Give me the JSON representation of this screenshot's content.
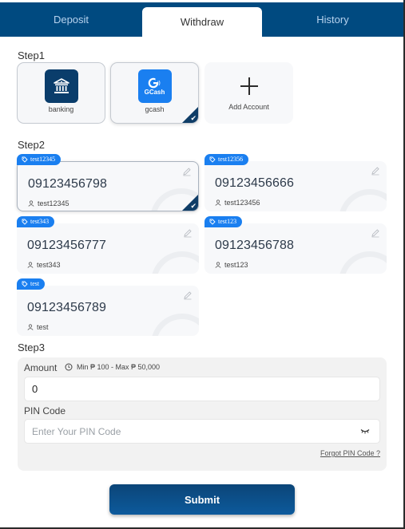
{
  "tabs": [
    {
      "label": "Deposit",
      "active": false
    },
    {
      "label": "Withdraw",
      "active": true
    },
    {
      "label": "History",
      "active": false
    }
  ],
  "step1": {
    "label": "Step1",
    "methods": [
      {
        "label": "banking",
        "icon": "bank-icon",
        "selected": false
      },
      {
        "label": "gcash",
        "icon": "gcash-logo",
        "logo_text": "GCash",
        "selected": true
      },
      {
        "label": "Add Account",
        "icon": "plus-icon"
      }
    ]
  },
  "step2": {
    "label": "Step2",
    "accounts": [
      {
        "tag": "test12345",
        "number": "09123456798",
        "name": "test12345",
        "selected": true
      },
      {
        "tag": "test12356",
        "number": "09123456666",
        "name": "test123456",
        "selected": false
      },
      {
        "tag": "test343",
        "number": "09123456777",
        "name": "test343",
        "selected": false
      },
      {
        "tag": "test123",
        "number": "09123456788",
        "name": "test123",
        "selected": false
      },
      {
        "tag": "test",
        "number": "09123456789",
        "name": "test",
        "selected": false
      }
    ]
  },
  "step3": {
    "label": "Step3",
    "amount_label": "Amount",
    "amount_hint": "Min ₱ 100 - Max ₱ 50,000",
    "amount_value": "0",
    "pin_label": "PIN Code",
    "pin_placeholder": "Enter Your PIN Code",
    "forgot_label": "Forgot PIN Code ?"
  },
  "submit_label": "Submit",
  "colors": {
    "brand_navy": "#004a80",
    "tag_blue": "#1a7ff0",
    "check_corner": "#0f3d67"
  }
}
